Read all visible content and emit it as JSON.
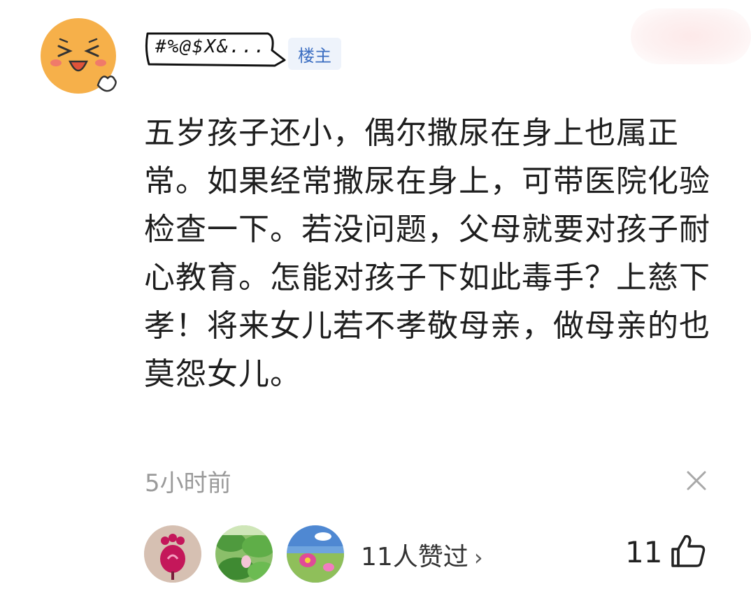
{
  "author": {
    "name": "#%@$X&...",
    "badge": "楼主"
  },
  "comment": {
    "text": "五岁孩子还小，偶尔撒尿在身上也属正常。如果经常撒尿在身上，可带医院化验检查一下。若没问题，父母就要对孩子耐心教育。怎能对孩子下如此毒手？上慈下孝！将来女儿若不孝敬母亲，做母亲的也莫怨女儿。",
    "time": "5小时前"
  },
  "likes": {
    "summary": "11人赞过",
    "chevron": "›",
    "count": "11"
  },
  "icons": {
    "close": "close-icon",
    "like": "thumbs-up-icon"
  },
  "colors": {
    "badge_text": "#3d6fc2",
    "badge_bg": "#eef3fb",
    "avatar": "#f6b04a",
    "muted": "#9a9a9a"
  }
}
